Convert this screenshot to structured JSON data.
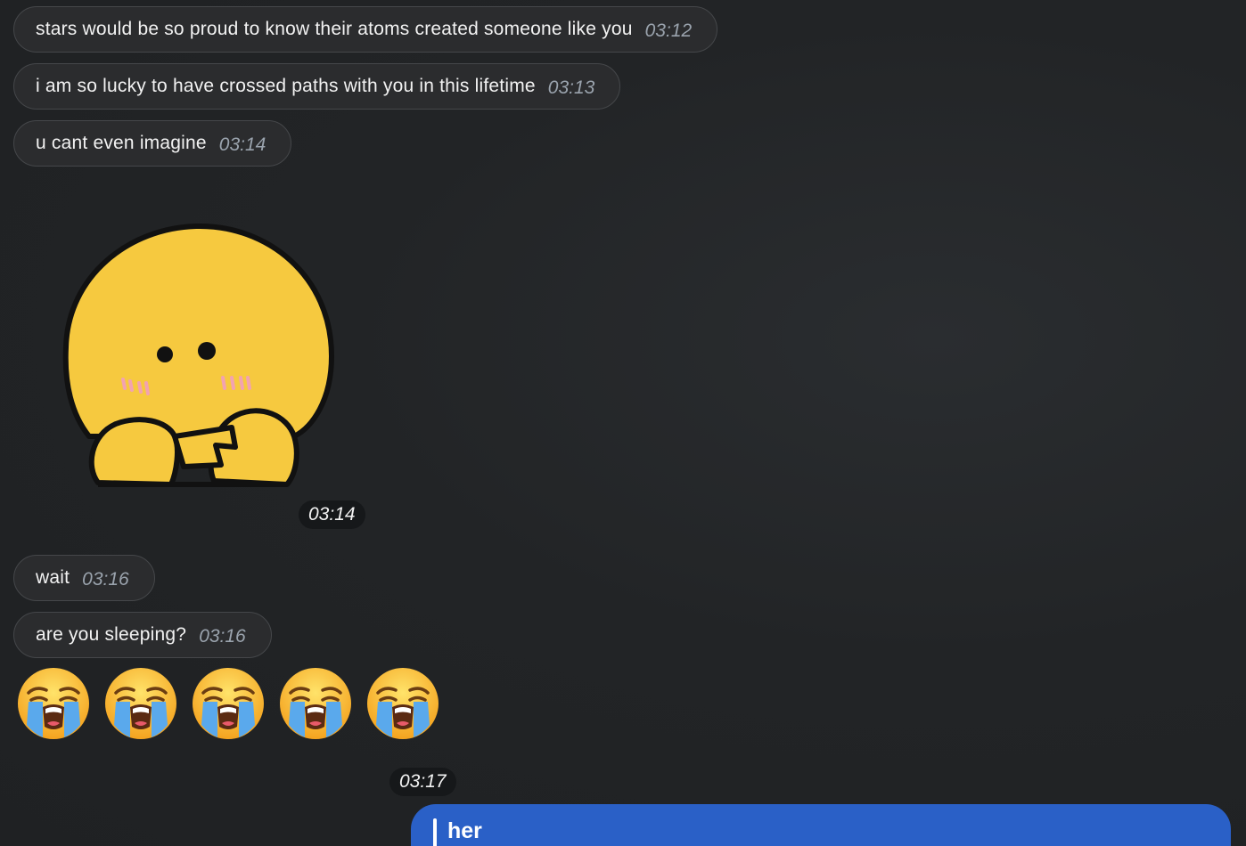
{
  "messages": [
    {
      "text": "stars would be so proud to know their atoms created someone like you",
      "time": "03:12"
    },
    {
      "text": "i am so lucky to have crossed paths with you in this lifetime",
      "time": "03:13"
    },
    {
      "text": "u cant even imagine",
      "time": "03:14"
    },
    {
      "text": "wait",
      "time": "03:16"
    },
    {
      "text": "are you sleeping?",
      "time": "03:16"
    }
  ],
  "sticker": {
    "time": "03:14",
    "icon": "shy-yellow-chick-sticker"
  },
  "emoji_message": {
    "time": "03:17",
    "emoji": "loudly-crying-face",
    "count": 5
  },
  "outgoing": {
    "reply_name": "her",
    "color": "#2a60c7"
  }
}
